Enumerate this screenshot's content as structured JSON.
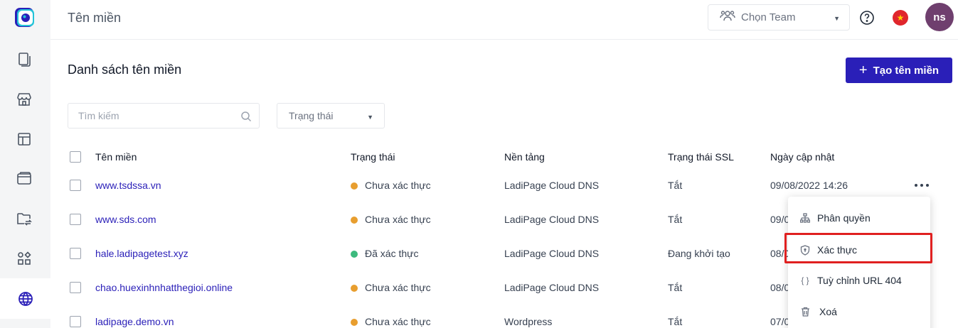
{
  "header": {
    "title": "Tên miền",
    "team_select": "Chọn Team",
    "avatar_initials": "ns"
  },
  "content": {
    "section_title": "Danh sách tên miền",
    "create_button": "Tạo tên miền",
    "search_placeholder": "Tìm kiếm",
    "status_filter": "Trạng thái"
  },
  "table": {
    "columns": [
      "Tên miền",
      "Trạng thái",
      "Nền tảng",
      "Trạng thái SSL",
      "Ngày cập nhật"
    ],
    "rows": [
      {
        "domain": "www.tsdssa.vn",
        "status": "Chưa xác thực",
        "status_color": "#e89e2f",
        "platform": "LadiPage Cloud DNS",
        "ssl": "Tắt",
        "updated": "09/08/2022 14:26"
      },
      {
        "domain": "www.sds.com",
        "status": "Chưa xác thực",
        "status_color": "#e89e2f",
        "platform": "LadiPage Cloud DNS",
        "ssl": "Tắt",
        "updated": "09/0"
      },
      {
        "domain": "hale.ladipagetest.xyz",
        "status": "Đã xác thực",
        "status_color": "#3dba7e",
        "platform": "LadiPage Cloud DNS",
        "ssl": "Đang khởi tạo",
        "updated": "08/0"
      },
      {
        "domain": "chao.huexinhnhatthegioi.online",
        "status": "Chưa xác thực",
        "status_color": "#e89e2f",
        "platform": "LadiPage Cloud DNS",
        "ssl": "Tắt",
        "updated": "08/0"
      },
      {
        "domain": "ladipage.demo.vn",
        "status": "Chưa xác thực",
        "status_color": "#e89e2f",
        "platform": "Wordpress",
        "ssl": "Tắt",
        "updated": "07/0"
      }
    ]
  },
  "menu": {
    "items": [
      {
        "label": "Phân quyền",
        "icon": "sitemap-icon"
      },
      {
        "label": "Xác thực",
        "icon": "shield-icon"
      },
      {
        "label": "Tuỳ chỉnh URL 404",
        "icon": "braces-icon"
      },
      {
        "label": "Xoá",
        "icon": "trash-icon"
      }
    ]
  },
  "colors": {
    "primary": "#2a1fb8",
    "highlight": "#e02020",
    "status_unverified": "#e89e2f",
    "status_verified": "#3dba7e"
  }
}
